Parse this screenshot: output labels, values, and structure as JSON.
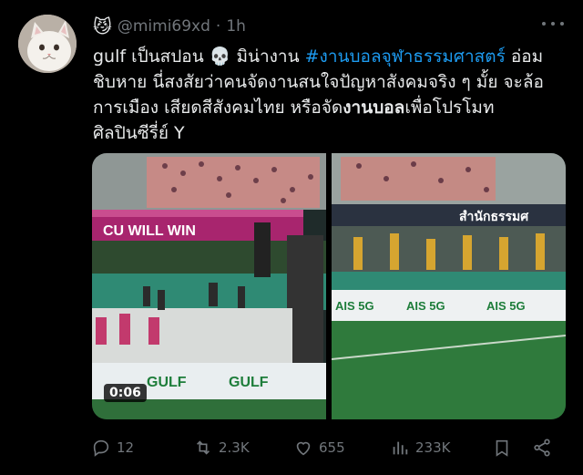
{
  "tweet": {
    "display_name_emoji": "😼",
    "handle": "@mimi69xd",
    "separator": "·",
    "time": "1h",
    "text": {
      "line1_a": "gulf เป็นสปอน ",
      "line1_skull": "💀",
      "line1_b": " มิน่างาน ",
      "hashtag": "#งานบอลจุฬาธรรมศาสตร์",
      "line1_c": " อ่อม",
      "line2": "ชิบหาย นี่สงสัยว่าคนจัดงานสนใจปัญหาสังคมจริง ๆ มั้ย จะล้อ",
      "line3_a": "การเมือง เสียดสีสังคมไทย หรือจัด",
      "line3_bold": "งานบอล",
      "line3_b": "เพื่อโปรโมท",
      "line4": "ศิลปินซีรี่ย์ Y"
    }
  },
  "media": {
    "duration": "0:06",
    "left_banner_text": "CU WILL WIN",
    "left_board_text": "GULF",
    "right_top_text": "สำนักธรรมศ",
    "right_board_text": "AIS 5G"
  },
  "actions": {
    "replies": "12",
    "reposts": "2.3K",
    "likes": "655",
    "views": "233K"
  },
  "colors": {
    "accent": "#1d9bf0",
    "muted": "#71767b",
    "text": "#e7e9ea"
  }
}
